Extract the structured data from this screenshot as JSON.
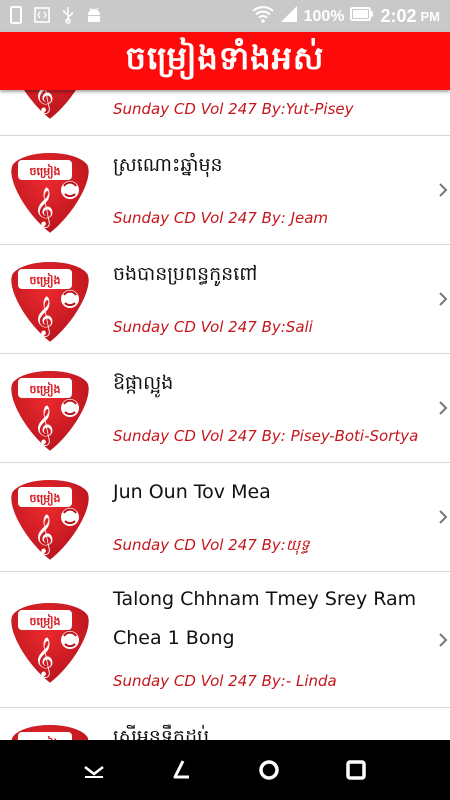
{
  "status_bar": {
    "battery_percent": "100%",
    "time": "2:02",
    "ampm": "PM",
    "icons": [
      "phone-icon",
      "code-icon",
      "usb-icon",
      "android-icon",
      "wifi-icon",
      "signal-icon",
      "battery-icon"
    ]
  },
  "header": {
    "title": "ចម្រៀងទាំងអស់"
  },
  "songs": [
    {
      "title": "",
      "subtitle": "Sunday CD Vol 247 By:Yut-Pisey"
    },
    {
      "title": "ស្រណោះឆ្នាំមុន",
      "subtitle": "Sunday CD Vol 247 By: Jeam"
    },
    {
      "title": "ចងបានប្រពន្ធកូនពៅ",
      "subtitle": "Sunday CD Vol 247 By:Sali"
    },
    {
      "title": "ឱផ្កាល្អូង",
      "subtitle": "Sunday CD Vol 247 By: Pisey-Boti-Sortya"
    },
    {
      "title": "Jun Oun Tov Mea",
      "subtitle": "Sunday CD Vol 247 By:យុទ្ធ"
    },
    {
      "title": "Talong Chhnam Tmey Srey Ram Chea 1 Bong",
      "subtitle": "Sunday CD Vol 247 By:- Linda"
    },
    {
      "title": "ស្រីអូនទឹកដប់",
      "subtitle": ""
    }
  ],
  "thumb_label": "ចម្រៀង",
  "colors": {
    "accent": "#ff0a0a",
    "subtitle": "#c4161c",
    "thumb": "#d7191f"
  },
  "navbar": {
    "icons": [
      "back-chevron-icon",
      "recents-slash-icon",
      "home-circle-icon",
      "overview-square-icon"
    ]
  }
}
